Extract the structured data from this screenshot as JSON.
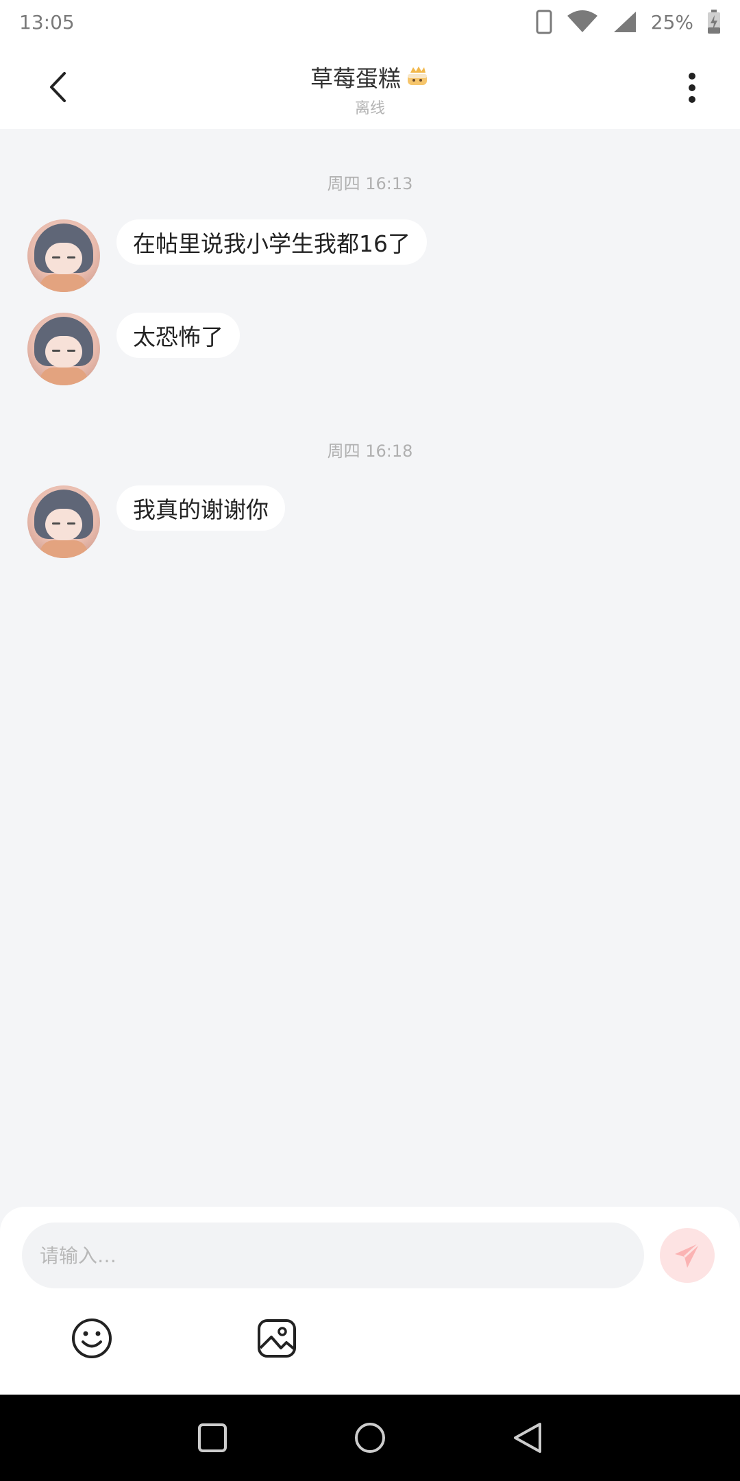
{
  "status_bar": {
    "time": "13:05",
    "battery": "25%"
  },
  "header": {
    "title": "草莓蛋糕",
    "title_emoji_icon": "cake-icon",
    "subtitle": "离线"
  },
  "messages": [
    {
      "type": "time",
      "text": "周四 16:13"
    },
    {
      "type": "incoming",
      "text": "在帖里说我小学生我都16了"
    },
    {
      "type": "incoming",
      "text": "太恐怖了"
    },
    {
      "type": "time",
      "text": "周四 16:18"
    },
    {
      "type": "incoming",
      "text": "我真的谢谢你"
    }
  ],
  "composer": {
    "placeholder": "请输入…",
    "send_icon": "send-icon",
    "tools": [
      "emoji-icon",
      "image-icon"
    ]
  },
  "colors": {
    "background": "#f4f5f7",
    "bubble": "#ffffff",
    "send_button": "#fde3e3",
    "send_icon": "#fbb3b3"
  }
}
